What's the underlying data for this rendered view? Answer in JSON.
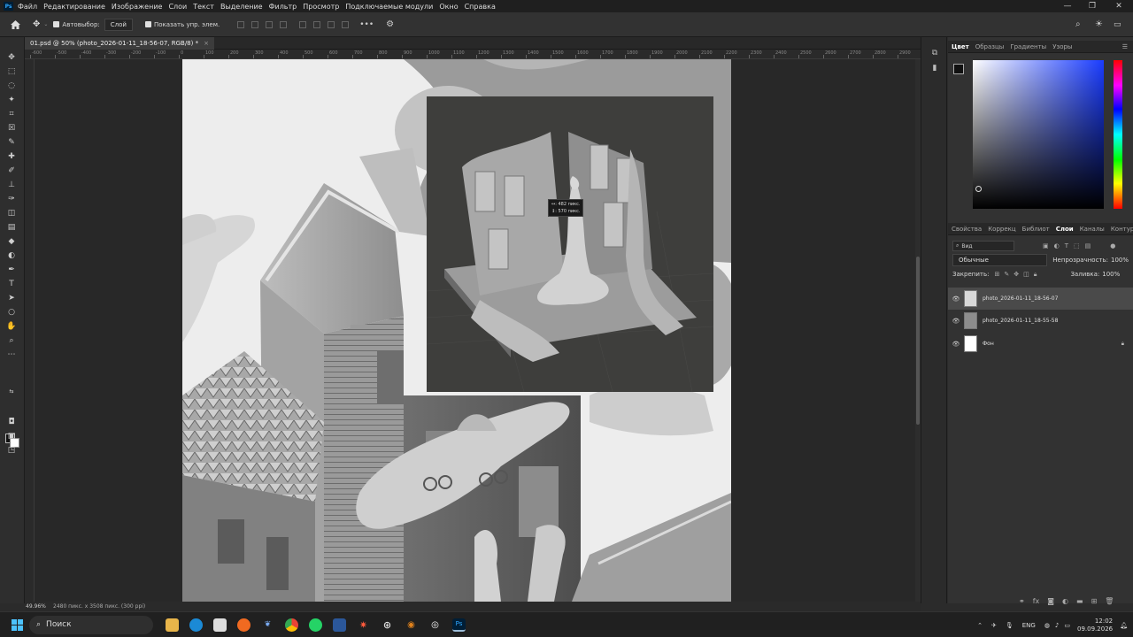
{
  "app": {
    "logo": "Ps"
  },
  "menu": [
    "Файл",
    "Редактирование",
    "Изображение",
    "Слои",
    "Текст",
    "Выделение",
    "Фильтр",
    "Просмотр",
    "Подключаемые модули",
    "Окно",
    "Справка"
  ],
  "options": {
    "autoselect_label": "Автовыбор:",
    "autoselect_value": "Слой",
    "show_controls_label": "Показать упр. элем.",
    "more": "•••"
  },
  "document": {
    "tab_title": "01.psd @ 50% (photo_2026-01-11_18-56-07, RGB/8) *",
    "close": "×"
  },
  "ruler_labels": [
    "-600",
    "-500",
    "-400",
    "-300",
    "-200",
    "-100",
    "0",
    "100",
    "200",
    "300",
    "400",
    "500",
    "600",
    "700",
    "800",
    "900",
    "1000",
    "1100",
    "1200",
    "1300",
    "1400",
    "1500",
    "1600",
    "1700",
    "1800",
    "1900",
    "2000",
    "2100",
    "2200",
    "2300",
    "2400",
    "2500",
    "2600",
    "2700",
    "2800",
    "2900"
  ],
  "measure_tooltip": {
    "w": "↔: 482 пикс.",
    "h": "↕: 570 пикс."
  },
  "status": {
    "zoom": "49.96%",
    "info": "2480 пикс. x 3508 пикс. (300 ppi)"
  },
  "color_panel": {
    "tabs": [
      "Цвет",
      "Образцы",
      "Градиенты",
      "Узоры"
    ],
    "active": 0
  },
  "layers_panel": {
    "tabs": [
      "Свойства",
      "Коррекц",
      "Библиот",
      "Слои",
      "Каналы",
      "Контуры"
    ],
    "active": 3,
    "search_placeholder": "Вид",
    "blend_mode": "Обычные",
    "opacity_label": "Непрозрачность:",
    "opacity_value": "100%",
    "lock_label": "Закрепить:",
    "fill_label": "Заливка:",
    "fill_value": "100%",
    "layers": [
      {
        "name": "photo_2026-01-11_18-56-07",
        "selected": true
      },
      {
        "name": "photo_2026-01-11_18-55-58",
        "selected": false
      },
      {
        "name": "Фон",
        "selected": false,
        "locked": true
      }
    ]
  },
  "taskbar": {
    "search": "Поиск",
    "lang": "ENG",
    "time": "12:02",
    "date": "09.09.2026"
  },
  "colors": {
    "accent": "#31a8ff",
    "ps_bg": "#001e36"
  }
}
